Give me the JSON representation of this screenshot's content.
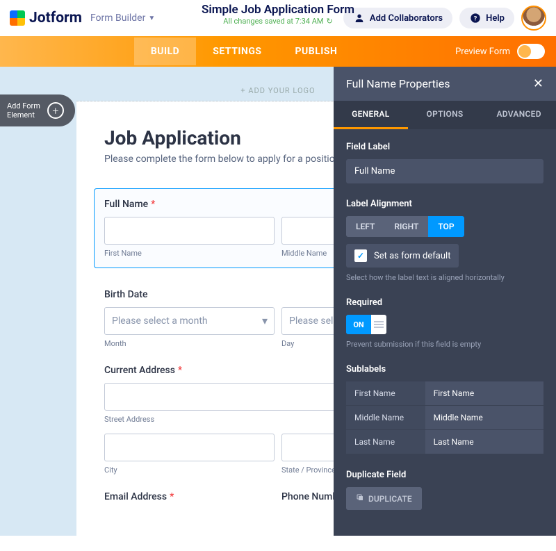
{
  "brand": "Jotform",
  "formBuilderLabel": "Form Builder",
  "formTitle": "Simple Job Application Form",
  "savedStatus": "All changes saved at 7:34 AM",
  "collab": "Add Collaborators",
  "help": "Help",
  "tabs": {
    "build": "BUILD",
    "settings": "SETTINGS",
    "publish": "PUBLISH"
  },
  "previewLabel": "Preview Form",
  "addElement": "Add Form\nElement",
  "logoPlaceholder": "+ ADD YOUR LOGO",
  "form": {
    "heading": "Job Application",
    "subheading": "Please complete the form below to apply for a position wi",
    "fullName": {
      "label": "Full Name",
      "sub1": "First Name",
      "sub2": "Middle Name"
    },
    "birthDate": {
      "label": "Birth Date",
      "monthPlaceholder": "Please select a month",
      "dayPlaceholder": "Please select a day",
      "subMonth": "Month",
      "subDay": "Day"
    },
    "address": {
      "label": "Current Address",
      "subStreet": "Street Address",
      "subCity": "City",
      "subState": "State / Province"
    },
    "email": {
      "label": "Email Address"
    },
    "phone": {
      "label": "Phone Numb"
    }
  },
  "props": {
    "title": "Full Name Properties",
    "tabs": {
      "general": "GENERAL",
      "options": "OPTIONS",
      "advanced": "ADVANCED"
    },
    "fieldLabel": {
      "label": "Field Label",
      "value": "Full Name"
    },
    "labelAlign": {
      "label": "Label Alignment",
      "left": "LEFT",
      "right": "RIGHT",
      "top": "TOP",
      "defaultChk": "Set as form default",
      "hint": "Select how the label text is aligned horizontally"
    },
    "required": {
      "label": "Required",
      "on": "ON",
      "hint": "Prevent submission if this field is empty"
    },
    "sublabels": {
      "label": "Sublabels",
      "rows": [
        {
          "key": "First Name",
          "val": "First Name"
        },
        {
          "key": "Middle Name",
          "val": "Middle Name"
        },
        {
          "key": "Last Name",
          "val": "Last Name"
        }
      ]
    },
    "duplicate": {
      "label": "Duplicate Field",
      "btn": "DUPLICATE"
    }
  }
}
